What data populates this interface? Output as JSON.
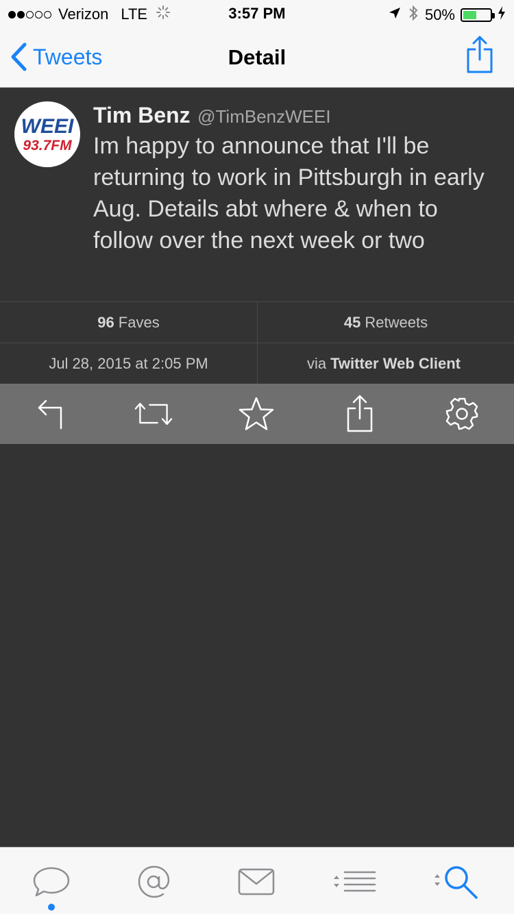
{
  "status_bar": {
    "carrier": "Verizon",
    "network": "LTE",
    "time": "3:57 PM",
    "battery": "50%",
    "battery_level": 0.5,
    "signal_bars_filled": 2,
    "signal_bars_total": 5
  },
  "nav": {
    "back_label": "Tweets",
    "title": "Detail",
    "share_icon": "share-icon",
    "back_icon": "chevron-left-icon"
  },
  "tweet": {
    "name": "Tim Benz",
    "handle": "@TimBenzWEEI",
    "text": "Im happy to announce that I'll be returning to work in Pittsburgh in early Aug. Details abt where & when to follow over the next week or two",
    "avatar": {
      "line1": "WEEI",
      "line2": "93.7FM"
    }
  },
  "stats": {
    "faves_count": "96",
    "faves_label": "Faves",
    "retweets_count": "45",
    "retweets_label": "Retweets",
    "date": "Jul 28, 2015 at 2:05 PM",
    "via_label": "via",
    "client": "Twitter Web Client"
  },
  "actions": [
    "reply-icon",
    "retweet-icon",
    "star-icon",
    "share-icon",
    "gear-icon"
  ],
  "tabs": [
    "timeline-bubble-icon",
    "mentions-at-icon",
    "messages-envelope-icon",
    "lists-icon",
    "search-icon"
  ],
  "colors": {
    "accent": "#1a82f7",
    "background": "#333333",
    "action_bar": "#6f6f6f",
    "battery": "#4cd964",
    "brand_blue": "#1f4e9c",
    "brand_red": "#d0202e"
  }
}
